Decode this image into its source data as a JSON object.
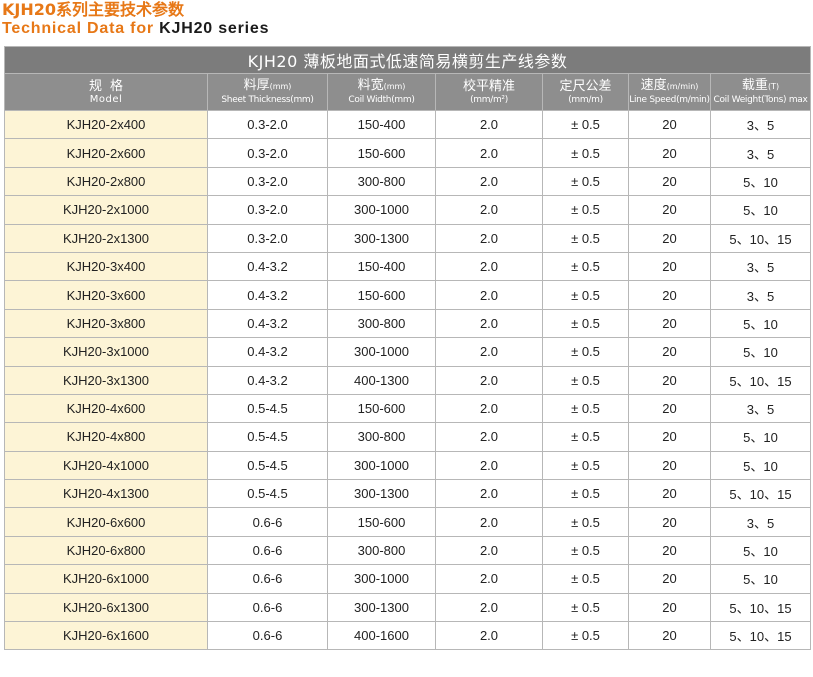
{
  "heading": {
    "cn": "KJH20系列主要技术参数",
    "en_prefix": "Technical Data for ",
    "en_series": "KJH20 series"
  },
  "table": {
    "title": "KJH20 薄板地面式低速简易横剪生产线参数",
    "columns": [
      {
        "main": "规格",
        "unit": "",
        "sub": "Model"
      },
      {
        "main": "料厚",
        "unit": "(mm)",
        "sub": "Sheet Thickness(mm)"
      },
      {
        "main": "料宽",
        "unit": "(mm)",
        "sub": "Coil Width(mm)"
      },
      {
        "main": "校平精准",
        "unit": "",
        "sub": "(mm/m²)"
      },
      {
        "main": "定尺公差",
        "unit": "",
        "sub": "(mm/m)"
      },
      {
        "main": "速度",
        "unit": "(m/min)",
        "sub": "Line Speed(m/min)"
      },
      {
        "main": "载重",
        "unit": "(T)",
        "sub": "Coil Weight(Tons) max"
      }
    ],
    "rows": [
      {
        "model": "KJH20-2x400",
        "thickness": "0.3-2.0",
        "width": "150-400",
        "leveling": "2.0",
        "tolerance": "± 0.5",
        "speed": "20",
        "weight": "3、5"
      },
      {
        "model": "KJH20-2x600",
        "thickness": "0.3-2.0",
        "width": "150-600",
        "leveling": "2.0",
        "tolerance": "± 0.5",
        "speed": "20",
        "weight": "3、5"
      },
      {
        "model": "KJH20-2x800",
        "thickness": "0.3-2.0",
        "width": "300-800",
        "leveling": "2.0",
        "tolerance": "± 0.5",
        "speed": "20",
        "weight": "5、10"
      },
      {
        "model": "KJH20-2x1000",
        "thickness": "0.3-2.0",
        "width": "300-1000",
        "leveling": "2.0",
        "tolerance": "± 0.5",
        "speed": "20",
        "weight": "5、10"
      },
      {
        "model": "KJH20-2x1300",
        "thickness": "0.3-2.0",
        "width": "300-1300",
        "leveling": "2.0",
        "tolerance": "± 0.5",
        "speed": "20",
        "weight": "5、10、15"
      },
      {
        "model": "KJH20-3x400",
        "thickness": "0.4-3.2",
        "width": "150-400",
        "leveling": "2.0",
        "tolerance": "± 0.5",
        "speed": "20",
        "weight": "3、5"
      },
      {
        "model": "KJH20-3x600",
        "thickness": "0.4-3.2",
        "width": "150-600",
        "leveling": "2.0",
        "tolerance": "± 0.5",
        "speed": "20",
        "weight": "3、5"
      },
      {
        "model": "KJH20-3x800",
        "thickness": "0.4-3.2",
        "width": "300-800",
        "leveling": "2.0",
        "tolerance": "± 0.5",
        "speed": "20",
        "weight": "5、10"
      },
      {
        "model": "KJH20-3x1000",
        "thickness": "0.4-3.2",
        "width": "300-1000",
        "leveling": "2.0",
        "tolerance": "± 0.5",
        "speed": "20",
        "weight": "5、10"
      },
      {
        "model": "KJH20-3x1300",
        "thickness": "0.4-3.2",
        "width": "400-1300",
        "leveling": "2.0",
        "tolerance": "± 0.5",
        "speed": "20",
        "weight": "5、10、15"
      },
      {
        "model": "KJH20-4x600",
        "thickness": "0.5-4.5",
        "width": "150-600",
        "leveling": "2.0",
        "tolerance": "± 0.5",
        "speed": "20",
        "weight": "3、5"
      },
      {
        "model": "KJH20-4x800",
        "thickness": "0.5-4.5",
        "width": "300-800",
        "leveling": "2.0",
        "tolerance": "± 0.5",
        "speed": "20",
        "weight": "5、10"
      },
      {
        "model": "KJH20-4x1000",
        "thickness": "0.5-4.5",
        "width": "300-1000",
        "leveling": "2.0",
        "tolerance": "± 0.5",
        "speed": "20",
        "weight": "5、10"
      },
      {
        "model": "KJH20-4x1300",
        "thickness": "0.5-4.5",
        "width": "300-1300",
        "leveling": "2.0",
        "tolerance": "± 0.5",
        "speed": "20",
        "weight": "5、10、15"
      },
      {
        "model": "KJH20-6x600",
        "thickness": "0.6-6",
        "width": "150-600",
        "leveling": "2.0",
        "tolerance": "± 0.5",
        "speed": "20",
        "weight": "3、5"
      },
      {
        "model": "KJH20-6x800",
        "thickness": "0.6-6",
        "width": "300-800",
        "leveling": "2.0",
        "tolerance": "± 0.5",
        "speed": "20",
        "weight": "5、10"
      },
      {
        "model": "KJH20-6x1000",
        "thickness": "0.6-6",
        "width": "300-1000",
        "leveling": "2.0",
        "tolerance": "± 0.5",
        "speed": "20",
        "weight": "5、10"
      },
      {
        "model": "KJH20-6x1300",
        "thickness": "0.6-6",
        "width": "300-1300",
        "leveling": "2.0",
        "tolerance": "± 0.5",
        "speed": "20",
        "weight": "5、10、15"
      },
      {
        "model": "KJH20-6x1600",
        "thickness": "0.6-6",
        "width": "400-1600",
        "leveling": "2.0",
        "tolerance": "± 0.5",
        "speed": "20",
        "weight": "5、10、15"
      }
    ]
  },
  "colors": {
    "heading_orange": "#e77817",
    "title_bar_gray": "#7c7c7c",
    "header_gray": "#8e8e8e",
    "model_cell_cream": "#fdf4d6",
    "grid_line": "#b7b7b7"
  }
}
